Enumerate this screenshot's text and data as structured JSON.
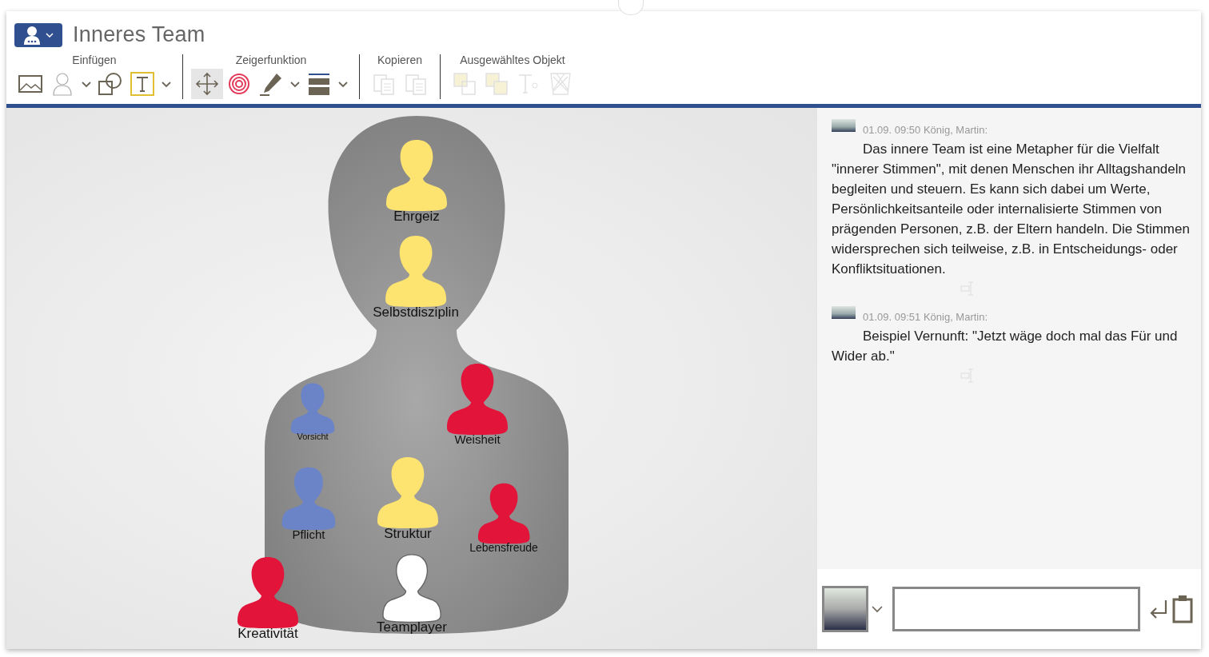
{
  "title": "Inneres Team",
  "toolbar_groups": [
    {
      "label": "Einfügen",
      "tools": [
        {
          "kind": "image",
          "selected": false,
          "disabled": false
        },
        {
          "kind": "person",
          "selected": false,
          "disabled": false,
          "dropdown": true
        },
        {
          "kind": "shapes",
          "selected": false,
          "disabled": false
        },
        {
          "kind": "text",
          "selected": false,
          "disabled": false,
          "dropdown": true
        }
      ]
    },
    {
      "label": "Zeigerfunktion",
      "tools": [
        {
          "kind": "move",
          "selected": true,
          "disabled": false
        },
        {
          "kind": "target",
          "selected": false,
          "disabled": false
        },
        {
          "kind": "pen",
          "selected": false,
          "disabled": false,
          "dropdown": true
        },
        {
          "kind": "lines",
          "selected": false,
          "disabled": false,
          "dropdown": true
        }
      ]
    },
    {
      "label": "Kopieren",
      "tools": [
        {
          "kind": "copy",
          "selected": false,
          "disabled": true
        },
        {
          "kind": "paste",
          "selected": false,
          "disabled": true
        }
      ]
    },
    {
      "label": "Ausgewähltes Objekt",
      "tools": [
        {
          "kind": "front",
          "selected": false,
          "disabled": true
        },
        {
          "kind": "back",
          "selected": false,
          "disabled": true
        },
        {
          "kind": "textformat",
          "selected": false,
          "disabled": true
        },
        {
          "kind": "delete",
          "selected": false,
          "disabled": true
        }
      ]
    }
  ],
  "figures": [
    {
      "label": "Ehrgeiz",
      "color": "#fde36f"
    },
    {
      "label": "Selbstdisziplin",
      "color": "#fde36f"
    },
    {
      "label": "Vorsicht",
      "color": "#6b84c8"
    },
    {
      "label": "Weisheit",
      "color": "#e3143a"
    },
    {
      "label": "Pflicht",
      "color": "#6b84c8"
    },
    {
      "label": "Struktur",
      "color": "#fde36f"
    },
    {
      "label": "Lebensfreude",
      "color": "#e3143a"
    },
    {
      "label": "Kreativität",
      "color": "#e3143a"
    },
    {
      "label": "Teamplayer",
      "color": "#ffffff"
    }
  ],
  "comments": [
    {
      "meta": "01.09. 09:50 König, Martin:",
      "text": "Das innere Team ist eine Metapher für die Vielfalt \"innerer Stimmen\", mit denen Menschen ihr Alltagshandeln begleiten und steuern. Es kann sich dabei um Werte, Persönlichkeitsanteile oder internalisierte Stimmen von prägenden Personen, z.B. der Eltern handeln. Die Stimmen widersprechen sich teilweise, z.B. in Entscheidungs- oder Konfliktsituationen."
    },
    {
      "meta": "01.09. 09:51 König, Martin:",
      "text": "Beispiel Vernunft: \"Jetzt wäge doch mal das Für und Wider ab.\""
    }
  ]
}
